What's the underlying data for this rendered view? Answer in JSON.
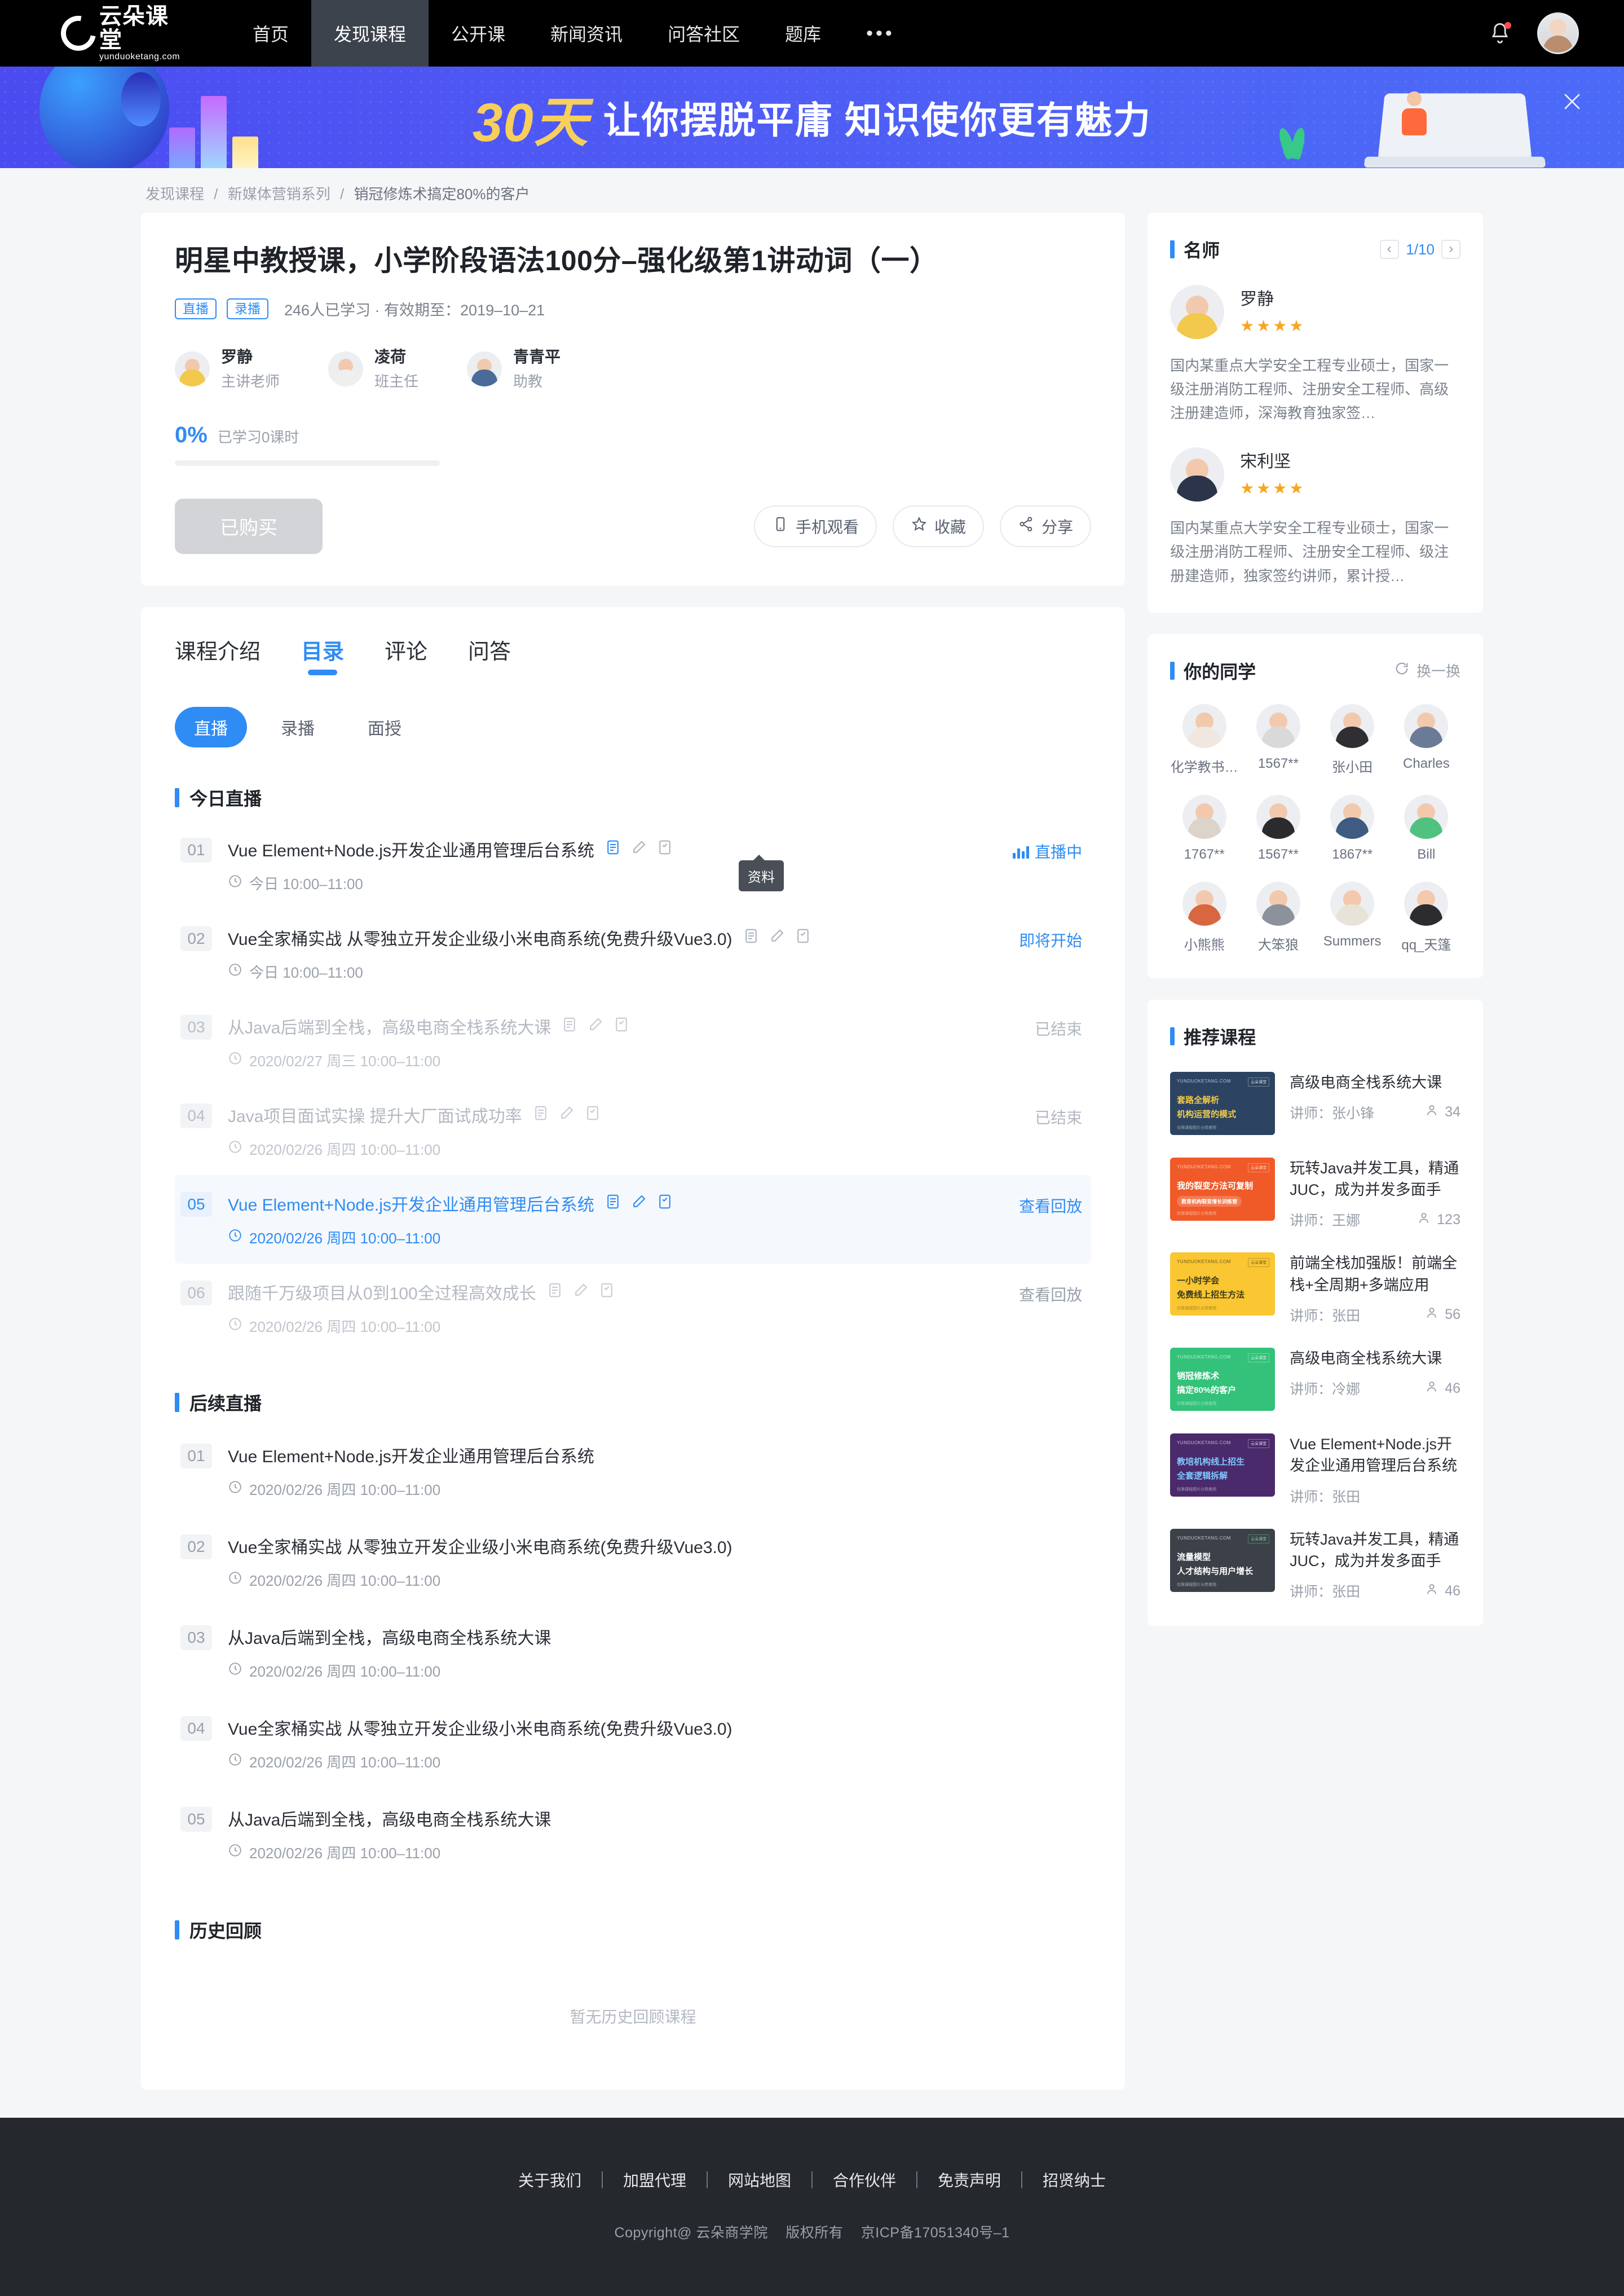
{
  "brand": {
    "name_cn": "云朵课堂",
    "name_en": "yunduoketang.com"
  },
  "nav": {
    "items": [
      {
        "label": "首页",
        "active": false
      },
      {
        "label": "发现课程",
        "active": true
      },
      {
        "label": "公开课",
        "active": false
      },
      {
        "label": "新闻资讯",
        "active": false
      },
      {
        "label": "问答社区",
        "active": false
      },
      {
        "label": "题库",
        "active": false
      },
      {
        "label": "•••",
        "active": false
      }
    ]
  },
  "banner": {
    "days": "30天",
    "headline": "让你摆脱平庸 知识使你更有魅力",
    "close_label": "×"
  },
  "breadcrumb": {
    "l1": "发现课程",
    "l2": "新媒体营销系列",
    "l3": "销冠修炼术搞定80%的客户"
  },
  "hero": {
    "title": "明星中教授课，小学阶段语法100分–强化级第1讲动词（一）",
    "tags": [
      "直播",
      "录播"
    ],
    "meta": "246人已学习 · 有效期至：2019–10–21",
    "teachers": [
      {
        "name": "罗静",
        "role": "主讲老师",
        "color": "#f2c94c"
      },
      {
        "name": "凌荷",
        "role": "班主任",
        "color": "#efefef"
      },
      {
        "name": "青青平",
        "role": "助教",
        "color": "#4a6b9a"
      }
    ],
    "progress": {
      "percent": "0%",
      "label": "已学习0课时",
      "value": 0
    },
    "buy_button": "已购买",
    "actions": [
      {
        "label": "手机观看",
        "icon": "phone-icon"
      },
      {
        "label": "收藏",
        "icon": "star-icon"
      },
      {
        "label": "分享",
        "icon": "share-icon"
      }
    ]
  },
  "tabs": [
    {
      "label": "课程介绍",
      "active": false
    },
    {
      "label": "目录",
      "active": true
    },
    {
      "label": "评论",
      "active": false
    },
    {
      "label": "问答",
      "active": false
    }
  ],
  "pills": [
    {
      "label": "直播",
      "active": true
    },
    {
      "label": "录播",
      "active": false
    },
    {
      "label": "面授",
      "active": false
    }
  ],
  "tooltip": "资料",
  "sections": {
    "today": {
      "title": "今日直播",
      "lessons": [
        {
          "idx": "01",
          "title": "Vue Element+Node.js开发企业通用管理后台系统",
          "time": "今日 10:00–11:00",
          "status": "直播中",
          "status_type": "live",
          "state": "active"
        },
        {
          "idx": "02",
          "title": "Vue全家桶实战 从零独立开发企业级小米电商系统(免费升级Vue3.0)",
          "time": "今日 10:00–11:00",
          "status": "即将开始",
          "status_type": "soon",
          "state": "active"
        },
        {
          "idx": "03",
          "title": "从Java后端到全栈，高级电商全栈系统大课",
          "time": "2020/02/27 周三 10:00–11:00",
          "status": "已结束",
          "status_type": "ended",
          "state": "past"
        },
        {
          "idx": "04",
          "title": "Java项目面试实操 提升大厂面试成功率",
          "time": "2020/02/26 周四 10:00–11:00",
          "status": "已结束",
          "status_type": "ended",
          "state": "past"
        },
        {
          "idx": "05",
          "title": "Vue Element+Node.js开发企业通用管理后台系统",
          "time": "2020/02/26 周四 10:00–11:00",
          "status": "查看回放",
          "status_type": "replay",
          "state": "highlight"
        },
        {
          "idx": "06",
          "title": "跟随千万级项目从0到100全过程高效成长",
          "time": "2020/02/26 周四 10:00–11:00",
          "status": "查看回放",
          "status_type": "replay",
          "state": "normal"
        }
      ]
    },
    "upcoming": {
      "title": "后续直播",
      "lessons": [
        {
          "idx": "01",
          "title": "Vue Element+Node.js开发企业通用管理后台系统",
          "time": "2020/02/26 周四 10:00–11:00"
        },
        {
          "idx": "02",
          "title": "Vue全家桶实战 从零独立开发企业级小米电商系统(免费升级Vue3.0)",
          "time": "2020/02/26 周四 10:00–11:00"
        },
        {
          "idx": "03",
          "title": "从Java后端到全栈，高级电商全栈系统大课",
          "time": "2020/02/26 周四 10:00–11:00"
        },
        {
          "idx": "04",
          "title": "Vue全家桶实战 从零独立开发企业级小米电商系统(免费升级Vue3.0)",
          "time": "2020/02/26 周四 10:00–11:00"
        },
        {
          "idx": "05",
          "title": "从Java后端到全栈，高级电商全栈系统大课",
          "time": "2020/02/26 周四 10:00–11:00"
        }
      ]
    },
    "history": {
      "title": "历史回顾",
      "empty": "暂无历史回顾课程"
    }
  },
  "sidebar": {
    "masters": {
      "title": "名师",
      "pager": "1/10",
      "items": [
        {
          "name": "罗静",
          "stars": "★★★★",
          "desc": "国内某重点大学安全工程专业硕士，国家一级注册消防工程师、注册安全工程师、高级注册建造师，深海教育独家签…",
          "color": "#f2c94c"
        },
        {
          "name": "宋利坚",
          "stars": "★★★★",
          "desc": "国内某重点大学安全工程专业硕士，国家一级注册消防工程师、注册安全工程师、级注册建造师，独家签约讲师，累计授…",
          "color": "#2b3448"
        }
      ]
    },
    "classmates": {
      "title": "你的同学",
      "swap": "换一换",
      "items": [
        {
          "name": "化学教书…",
          "color": "#f0e7e0"
        },
        {
          "name": "1567**",
          "color": "#d9d9d9"
        },
        {
          "name": "张小田",
          "color": "#2f2f33"
        },
        {
          "name": "Charles",
          "color": "#6b7b96"
        },
        {
          "name": "1767**",
          "color": "#dcd3cb"
        },
        {
          "name": "1567**",
          "color": "#2b2b2e"
        },
        {
          "name": "1867**",
          "color": "#3f5b82"
        },
        {
          "name": "Bill",
          "color": "#4fc27f"
        },
        {
          "name": "小熊熊",
          "color": "#d8663f"
        },
        {
          "name": "大笨狼",
          "color": "#8c929c"
        },
        {
          "name": "Summers",
          "color": "#e8e3d8"
        },
        {
          "name": "qq_天篷",
          "color": "#2c2c2f"
        }
      ]
    },
    "recommend": {
      "title": "推荐课程",
      "teacher_prefix": "讲师：",
      "items": [
        {
          "title": "高级电商全栈系统大课",
          "teacher": "张小锋",
          "count": "34",
          "thumb_color": "#2c4461",
          "thumb_l1": "套路全解析",
          "thumb_l2": "机构运营的模式",
          "thumb_text_color": "#f2c94c"
        },
        {
          "title": "玩转Java并发工具，精通JUC，成为并发多面手",
          "teacher": "王娜",
          "count": "123",
          "thumb_color": "#f05a28",
          "thumb_l1": "我的裂变方法可复制",
          "thumb_l2": "教育机构裂变增长训练营",
          "thumb_text_color": "#ffffff"
        },
        {
          "title": "前端全栈加强版！前端全栈+全周期+多端应用",
          "teacher": "张田",
          "count": "56",
          "thumb_color": "#fac631",
          "thumb_l1": "一小时学会",
          "thumb_l2": "免费线上招生方法",
          "thumb_text_color": "#3a3a1e"
        },
        {
          "title": "高级电商全栈系统大课",
          "teacher": "冷娜",
          "count": "46",
          "thumb_color": "#34c27a",
          "thumb_l1": "销冠修炼术",
          "thumb_l2": "搞定80%的客户",
          "thumb_text_color": "#ffffff"
        },
        {
          "title": "Vue Element+Node.js开发企业通用管理后台系统",
          "teacher": "张田",
          "count": "",
          "thumb_color": "#4a2a6b",
          "thumb_l1": "教培机构线上招生",
          "thumb_l2": "全套逻辑拆解",
          "thumb_text_color": "#7ec8ff"
        },
        {
          "title": "玩转Java并发工具，精通JUC，成为并发多面手",
          "teacher": "张田",
          "count": "46",
          "thumb_color": "#3c4149",
          "thumb_l1": "流量模型",
          "thumb_l2": "人才结构与用户增长",
          "thumb_text_color": "#ffffff"
        }
      ]
    }
  },
  "footer": {
    "links": [
      "关于我们",
      "加盟代理",
      "网站地图",
      "合作伙伴",
      "免责声明",
      "招贤纳士"
    ],
    "copyright": "Copyright@ 云朵商学院",
    "rights": "版权所有",
    "icp": "京ICP备17051340号–1"
  },
  "colors": {
    "accent": "#2f8cf4",
    "banner": "#4b55f2",
    "star": "#f6a623"
  }
}
